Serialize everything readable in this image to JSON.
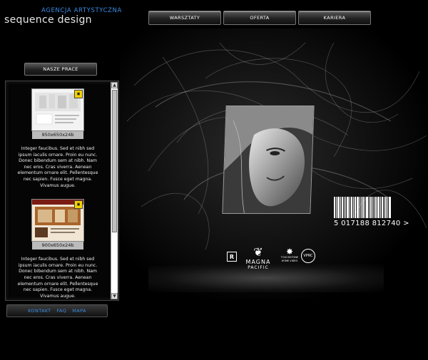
{
  "brand": {
    "tagline": "AGENCJA ARTYSTYCZNA",
    "name": "sequence design"
  },
  "nav": {
    "items": [
      {
        "label": "WARSZTATY"
      },
      {
        "label": "OFERTA"
      },
      {
        "label": "KARIERA"
      }
    ]
  },
  "section_button": {
    "label": "NASZE PRACE"
  },
  "works": [
    {
      "size_label": "950x650x24b",
      "description": "Integer faucibus. Sed et nibh sed ipsum iaculis ornare. Proin eu nunc. Donec bibendum sem at nibh. Nam nec eros. Cras viverra. Aenean elementum ornare elit. Pellentesque nec sapien. Fusce eget magna. Vivamus augue."
    },
    {
      "size_label": "900x650x24b",
      "description": "Integer faucibus. Sed et nibh sed ipsum iaculis ornare. Proin eu nunc. Donec bibendum sem at nibh. Nam nec eros. Cras viverra. Aenean elementum ornare elit. Pellentesque nec sapien. Fusce eget magna. Vivamus augue."
    }
  ],
  "footer_links": {
    "kontakt": "KONTAKT",
    "faq": "FAQ",
    "mapa": "MAPA"
  },
  "artwork": {
    "barcode_number": "5 017188 812740",
    "barcode_arrow": ">",
    "logos": {
      "rating": "R",
      "magna_line1": "MAGNA",
      "magna_line2": "PACIFIC",
      "touchstone": "TOUCHSTONE HOME VIDEO",
      "vprc": "VPRC"
    }
  },
  "colors": {
    "accent": "#3a8ee6",
    "background": "#000000"
  }
}
